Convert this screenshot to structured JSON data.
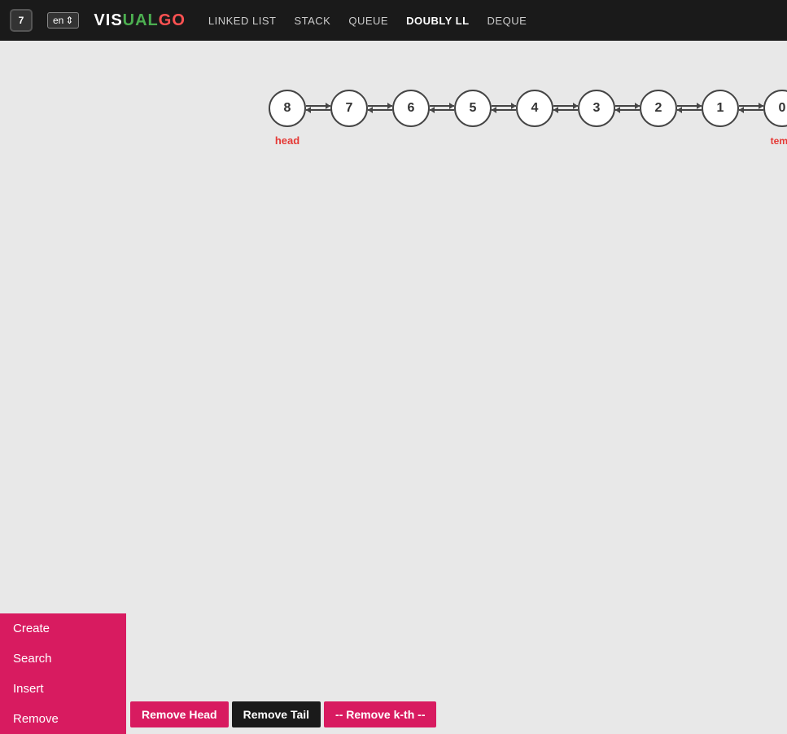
{
  "navbar": {
    "badge": "7",
    "lang": "en",
    "logo": {
      "part1": "VIS",
      "part2": "UAL",
      "part3": "GO"
    },
    "links": [
      {
        "label": "LINKED LIST",
        "active": false
      },
      {
        "label": "STACK",
        "active": false
      },
      {
        "label": "QUEUE",
        "active": false
      },
      {
        "label": "DOUBLY LL",
        "active": true
      },
      {
        "label": "DEQUE",
        "active": false
      }
    ]
  },
  "list": {
    "nodes": [
      {
        "value": "8",
        "label": "head",
        "labelSide": "bottom"
      },
      {
        "value": "7",
        "label": "",
        "labelSide": ""
      },
      {
        "value": "6",
        "label": "",
        "labelSide": ""
      },
      {
        "value": "5",
        "label": "",
        "labelSide": ""
      },
      {
        "value": "4",
        "label": "",
        "labelSide": ""
      },
      {
        "value": "3",
        "label": "",
        "labelSide": ""
      },
      {
        "value": "2",
        "label": "",
        "labelSide": ""
      },
      {
        "value": "1",
        "label": "",
        "labelSide": ""
      },
      {
        "value": "0",
        "label": "temp/oldtail",
        "labelSide": "bottom"
      }
    ]
  },
  "sidebar": {
    "items": [
      {
        "label": "Create"
      },
      {
        "label": "Search"
      },
      {
        "label": "Insert"
      },
      {
        "label": "Remove"
      }
    ]
  },
  "buttons": {
    "remove_head": "Remove Head",
    "remove_tail": "Remove Tail",
    "remove_kth": "-- Remove k-th --"
  }
}
